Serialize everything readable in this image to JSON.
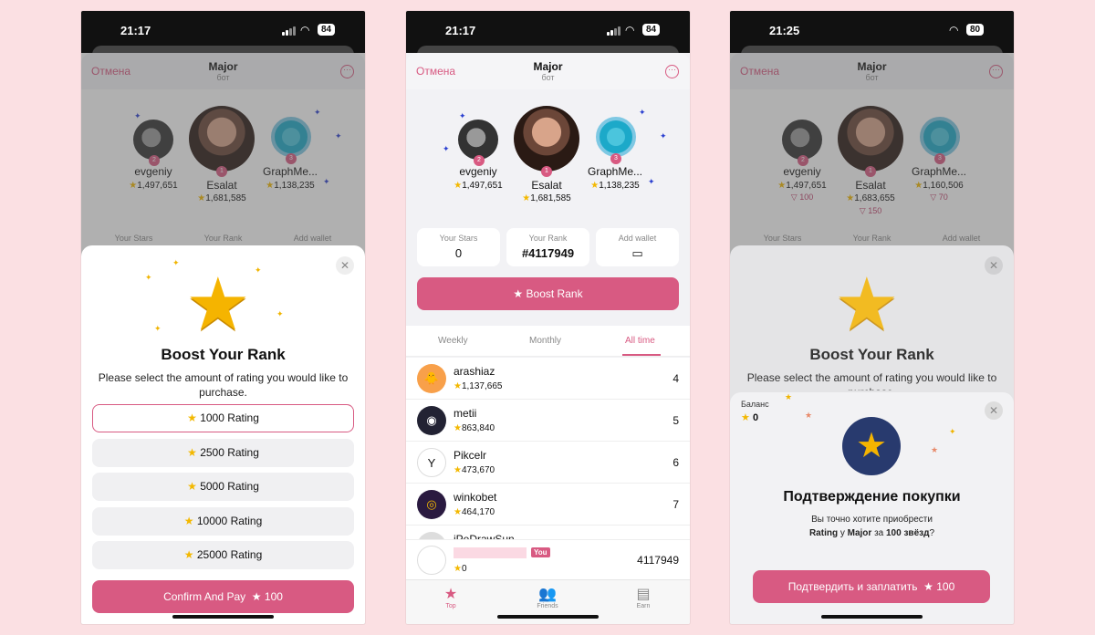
{
  "status": [
    {
      "time": "21:17",
      "battery": "84"
    },
    {
      "time": "21:17",
      "battery": "84"
    },
    {
      "time": "21:25",
      "battery": "80"
    }
  ],
  "nav": {
    "cancel": "Отмена",
    "title": "Major",
    "subtitle": "бот"
  },
  "podium": [
    {
      "name": "evgeniy",
      "score": "1,497,651",
      "rank": "2",
      "extra": "100"
    },
    {
      "name": "Esalat",
      "score": "1,681,585",
      "rank": "1",
      "extra": "150"
    },
    {
      "name": "GraphMe...",
      "score": "1,138,235",
      "rank": "3",
      "extra": "70"
    }
  ],
  "podium3_scores": [
    "1,497,651",
    "1,683,655",
    "1,160,506"
  ],
  "stats": {
    "stars_label": "Your Stars",
    "stars_value": "0",
    "rank_label": "Your Rank",
    "rank_value": "#4117949",
    "wallet_label": "Add wallet"
  },
  "boost_button": "Boost Rank",
  "tabs": [
    "Weekly",
    "Monthly",
    "All time"
  ],
  "leaderboard": [
    {
      "name": "arashiaz",
      "score": "1,137,665",
      "rank": "4",
      "avatar": "🐥",
      "bg": "#f8a04a"
    },
    {
      "name": "metii",
      "score": "863,840",
      "rank": "5",
      "avatar": "◉",
      "bg": "#223"
    },
    {
      "name": "Pikcelr",
      "score": "473,670",
      "rank": "6",
      "avatar": "Y",
      "bg": "#fff"
    },
    {
      "name": "winkobet",
      "score": "464,170",
      "rank": "7",
      "avatar": "◎",
      "bg": "#2a1a40"
    },
    {
      "name": "iPeDrawSun",
      "score": "",
      "rank": "",
      "avatar": "",
      "bg": "#ddd"
    }
  ],
  "you": {
    "tag": "You",
    "score": "0",
    "rank": "4117949"
  },
  "bottom_nav": [
    {
      "label": "Top",
      "icon": "★"
    },
    {
      "label": "Friends",
      "icon": "👥"
    },
    {
      "label": "Earn",
      "icon": "▤"
    }
  ],
  "boost_sheet": {
    "title": "Boost Your Rank",
    "desc": "Please select the amount of rating you would like to purchase.",
    "options": [
      "1000 Rating",
      "2500 Rating",
      "5000 Rating",
      "10000 Rating",
      "25000 Rating"
    ],
    "pay_label": "Confirm And Pay",
    "pay_amount": "100"
  },
  "confirm": {
    "balance_label": "Баланс",
    "balance_value": "0",
    "title": "Подтверждение покупки",
    "text_line1": "Вы точно хотите приобрести",
    "item": "Rating",
    "text_mid": " у ",
    "bot": "Major",
    "text_for": " за ",
    "price": "100 звёзд",
    "text_end": "?",
    "button": "Подтвердить и заплатить",
    "button_amount": "100"
  },
  "colors": {
    "accent": "#d85a82",
    "star": "#f3b800",
    "background": "#fbe0e3"
  }
}
